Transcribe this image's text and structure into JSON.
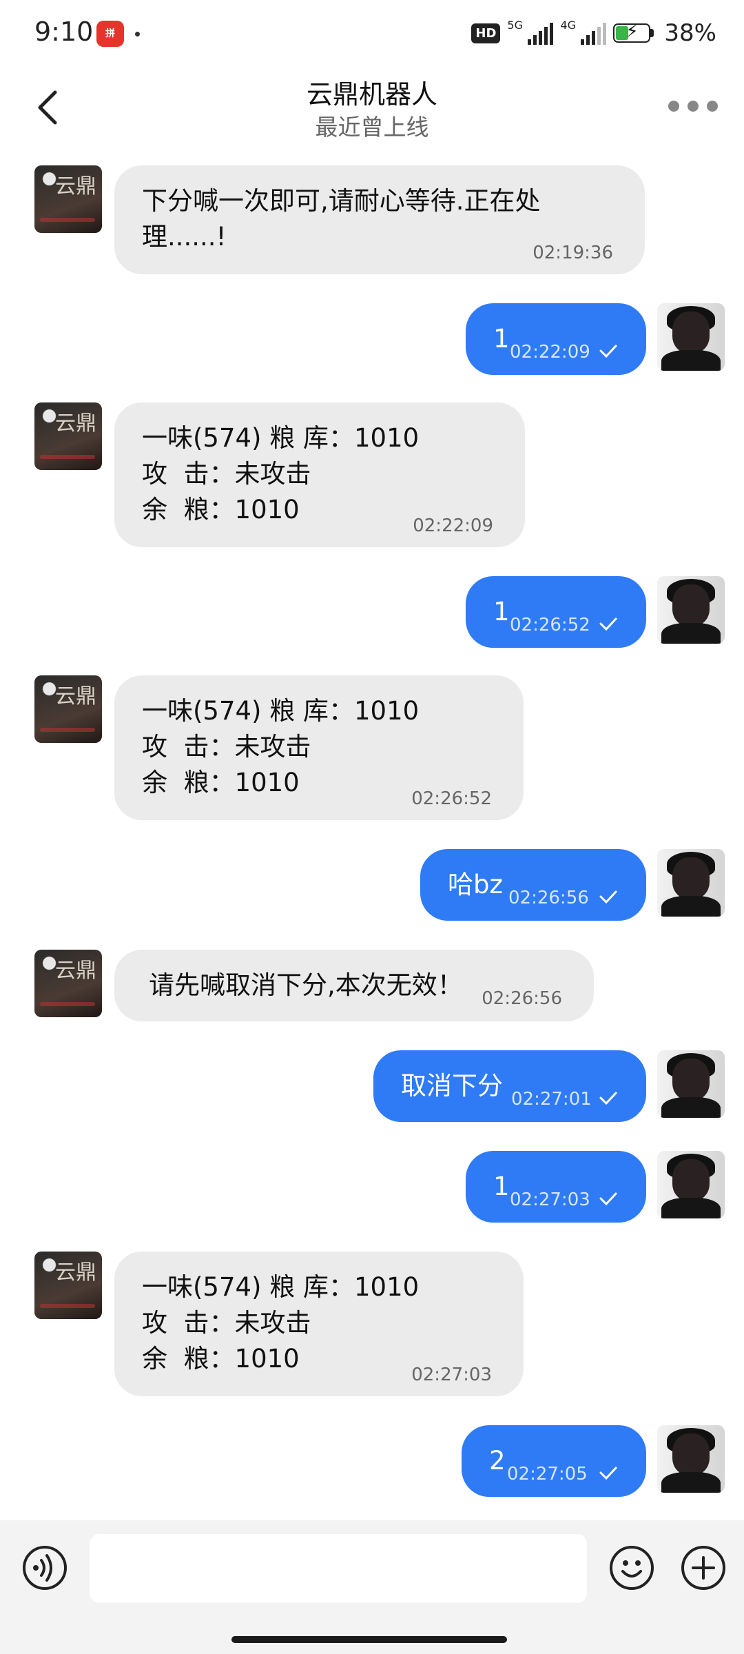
{
  "status_bar": {
    "time": "9:10",
    "app_badge": "拼多多",
    "network_hd": "HD",
    "net_5g": "5G",
    "net_4g": "4G",
    "battery": "38%"
  },
  "header": {
    "title": "云鼎机器人",
    "subtitle": "最近曾上线"
  },
  "bot_avatar_text": "云鼎",
  "messages": [
    {
      "text": "下分喊一次即可,请耐心等待.正在处\n理......!",
      "time": "02:19:36"
    },
    {
      "text": "1",
      "time": "02:22:09"
    },
    {
      "text": "一味(574) 粮 库：1010\n攻  击：未攻击\n余  粮：1010",
      "time": "02:22:09"
    },
    {
      "text": "1",
      "time": "02:26:52"
    },
    {
      "text": "一味(574) 粮 库：1010\n攻  击：未攻击\n余  粮：1010",
      "time": "02:26:52"
    },
    {
      "text": "哈bz",
      "time": "02:26:56"
    },
    {
      "text": "请先喊取消下分,本次无效！",
      "time": "02:26:56"
    },
    {
      "text": "取消下分",
      "time": "02:27:01"
    },
    {
      "text": "1",
      "time": "02:27:03"
    },
    {
      "text": "一味(574) 粮 库：1010\n攻  击：未攻击\n余  粮：1010",
      "time": "02:27:03"
    },
    {
      "text": "2",
      "time": "02:27:05"
    }
  ],
  "input": {
    "placeholder": ""
  }
}
